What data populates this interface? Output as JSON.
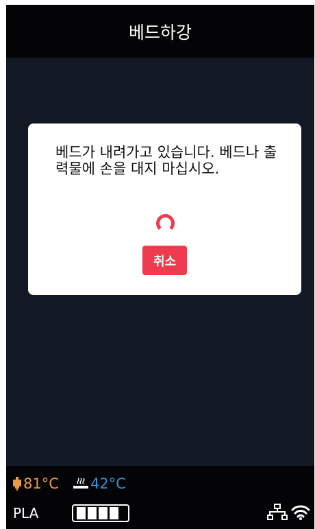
{
  "header": {
    "title": "베드하강"
  },
  "dialog": {
    "message": "베드가 내려가고 있습니다. 베드나 출력물에 손을 대지 마십시오.",
    "cancel_label": "취소"
  },
  "status": {
    "nozzle_temp": "81°C",
    "bed_temp": "42°C",
    "material": "PLA",
    "spool_level_segments": 4
  },
  "colors": {
    "accent": "#ee3b4d",
    "nozzle": "#e89a46",
    "bed": "#3a8fd6",
    "background": "#131924",
    "bars": "#040406"
  },
  "icons": {
    "nozzle": "nozzle-icon",
    "bed": "heated-bed-icon",
    "spool": "filament-spool-icon",
    "ethernet": "network-icon",
    "wifi": "wifi-icon"
  }
}
